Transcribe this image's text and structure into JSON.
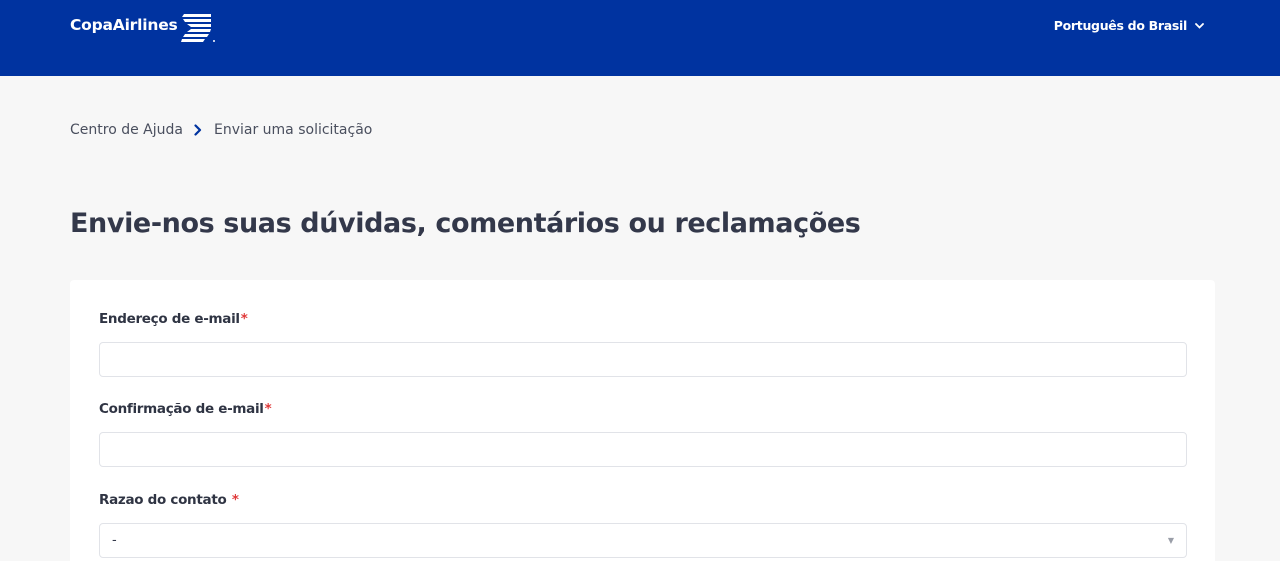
{
  "header": {
    "logo_text": "CopaAirlines",
    "language": "Português do Brasil",
    "language_icon": "chevron-down-icon",
    "colors": {
      "brand": "#0033a0",
      "background": "#f7f7f7",
      "required": "#e03a3a"
    }
  },
  "breadcrumb": {
    "items": [
      "Centro de Ajuda",
      "Enviar uma solicitação"
    ],
    "separator_icon": "chevron-right-icon"
  },
  "page_title": "Envie-nos suas dúvidas, comentários ou reclamações",
  "form": {
    "email": {
      "label": "Endereço de e-mail",
      "required_mark": "*",
      "value": ""
    },
    "email_confirm": {
      "label": "Confirmação de e-mail",
      "required_mark": "*",
      "value": ""
    },
    "contact_reason": {
      "label": "Razao do contato",
      "required_mark": "*",
      "selected": "-",
      "icon": "caret-down-icon"
    }
  }
}
